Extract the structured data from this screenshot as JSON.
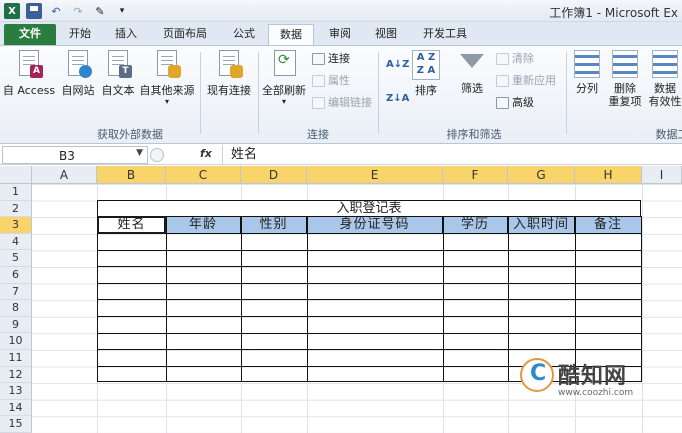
{
  "window": {
    "title": "工作簿1 - Microsoft Ex"
  },
  "tabs": [
    "文件",
    "开始",
    "插入",
    "页面布局",
    "公式",
    "数据",
    "审阅",
    "视图",
    "开发工具"
  ],
  "ribbon": {
    "external": {
      "access": "自 Access",
      "web": "自网站",
      "text": "自文本",
      "other": "自其他来源",
      "existing": "现有连接",
      "group": "获取外部数据"
    },
    "connections": {
      "refresh_all": "全部刷新",
      "connections": "连接",
      "properties": "属性",
      "edit_links": "编辑链接",
      "group": "连接"
    },
    "sort_filter": {
      "sort": "排序",
      "filter": "筛选",
      "clear": "清除",
      "reapply": "重新应用",
      "advanced": "高级",
      "group": "排序和筛选"
    },
    "data_tools": {
      "split": "分列",
      "remove_dup_1": "删除",
      "remove_dup_2": "重复项",
      "validation_1": "数据",
      "validation_2": "有效性",
      "group": "数据工"
    }
  },
  "formula_bar": {
    "name_box": "B3",
    "fx": "fx",
    "content": "姓名"
  },
  "columns": [
    "A",
    "B",
    "C",
    "D",
    "E",
    "F",
    "G",
    "H",
    "I"
  ],
  "rows": [
    "1",
    "2",
    "3",
    "4",
    "5",
    "6",
    "7",
    "8",
    "9",
    "10",
    "11",
    "12",
    "13",
    "14",
    "15"
  ],
  "sheet": {
    "title": "入职登记表",
    "headers": [
      "姓名",
      "年龄",
      "性别",
      "身份证号码",
      "学历",
      "入职时间",
      "备注"
    ]
  },
  "watermark": {
    "name": "酷知网",
    "url": "www.coozhi.com"
  }
}
